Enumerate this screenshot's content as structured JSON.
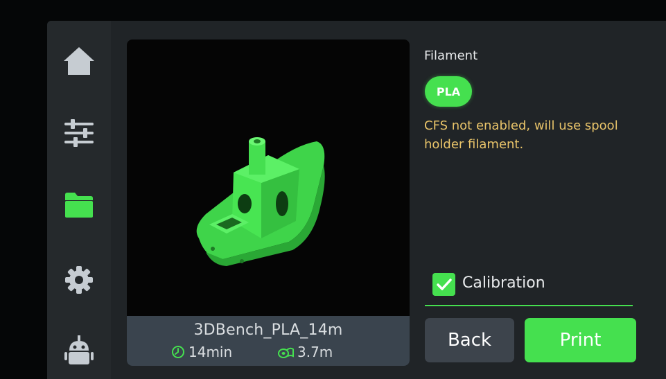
{
  "nav": {
    "items": [
      {
        "icon": "home-icon"
      },
      {
        "icon": "sliders-icon"
      },
      {
        "icon": "folder-icon",
        "active": true
      },
      {
        "icon": "gear-icon"
      },
      {
        "icon": "robot-icon"
      }
    ]
  },
  "preview": {
    "file_name": "3DBench_PLA_14m",
    "print_time": "14min",
    "filament_length": "3.7m"
  },
  "filament": {
    "title": "Filament",
    "type": "PLA",
    "note": "CFS not enabled, will use spool holder filament."
  },
  "calibration": {
    "label": "Calibration",
    "checked": true
  },
  "buttons": {
    "back": "Back",
    "print": "Print"
  },
  "colors": {
    "accent": "#45e04f",
    "warning_text": "#e9c46a",
    "background": "#202427",
    "button_dark": "#3d444c"
  }
}
